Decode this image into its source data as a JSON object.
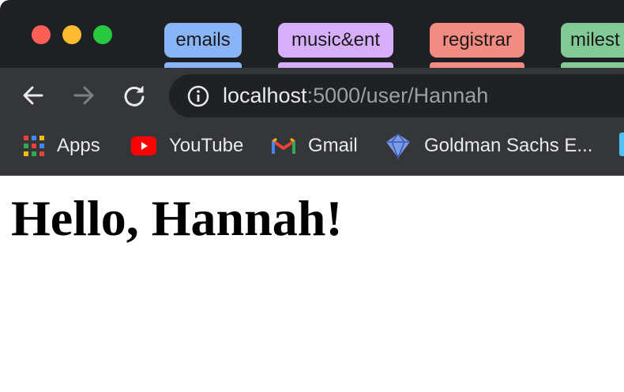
{
  "window": {
    "traffic_lights": [
      "#ff5f57",
      "#febc2e",
      "#28c840"
    ]
  },
  "tab_groups": [
    {
      "label": "emails",
      "color": "#8ab4f8"
    },
    {
      "label": "music&ent",
      "color": "#d7aefb"
    },
    {
      "label": "registrar",
      "color": "#f28b82"
    },
    {
      "label": "milest",
      "color": "#81c995"
    }
  ],
  "toolbar": {
    "back_icon": "arrow-left-icon",
    "forward_icon": "arrow-right-icon",
    "reload_icon": "reload-icon",
    "site_info_icon": "info-circle-icon"
  },
  "address_bar": {
    "host": "localhost",
    "path": ":5000/user/Hannah"
  },
  "bookmarks": [
    {
      "label": "Apps",
      "icon": "apps-grid-icon"
    },
    {
      "label": "YouTube",
      "icon": "youtube-icon"
    },
    {
      "label": "Gmail",
      "icon": "gmail-icon"
    },
    {
      "label": "Goldman Sachs E...",
      "icon": "goldman-sachs-icon"
    }
  ],
  "page": {
    "heading": "Hello, Hannah!"
  }
}
